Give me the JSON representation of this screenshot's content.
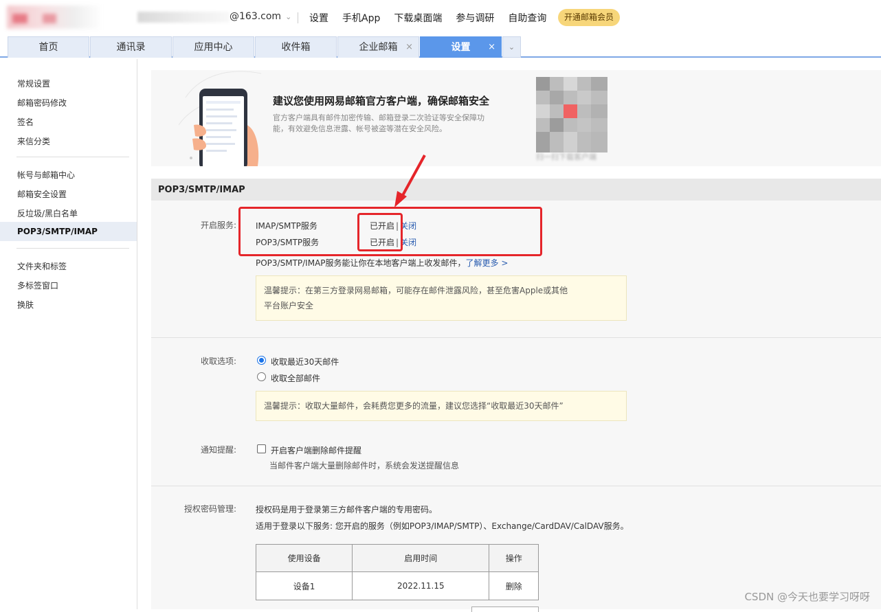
{
  "header": {
    "account_suffix": "@163.com",
    "links": [
      "设置",
      "手机App",
      "下载桌面端",
      "参与调研",
      "自助查询"
    ],
    "vip_button": "开通邮箱会员"
  },
  "tabs": [
    {
      "label": "首页",
      "closable": false,
      "active": false
    },
    {
      "label": "通讯录",
      "closable": false,
      "active": false
    },
    {
      "label": "应用中心",
      "closable": false,
      "active": false
    },
    {
      "label": "收件箱",
      "closable": false,
      "active": false
    },
    {
      "label": "企业邮箱",
      "closable": true,
      "active": false
    },
    {
      "label": "设置",
      "closable": true,
      "active": true
    }
  ],
  "sidebar": {
    "group1": [
      "常规设置",
      "邮箱密码修改",
      "签名",
      "来信分类"
    ],
    "group2": [
      "帐号与邮箱中心",
      "邮箱安全设置",
      "反垃圾/黑白名单",
      "POP3/SMTP/IMAP"
    ],
    "group3": [
      "文件夹和标签",
      "多标签窗口",
      "换肤"
    ],
    "active_item": "POP3/SMTP/IMAP"
  },
  "promo": {
    "title": "建议您使用网易邮箱官方客户端，确保邮箱安全",
    "desc": "官方客户端具有邮件加密传输、邮箱登录二次验证等安全保障功能，有效避免信息泄露、帐号被盗等潜在安全风险。",
    "qr_caption": "扫一扫下载客户端"
  },
  "section": {
    "title": "POP3/SMTP/IMAP",
    "services_label": "开启服务:",
    "services": [
      {
        "name": "IMAP/SMTP服务",
        "status": "已开启",
        "action": "关闭"
      },
      {
        "name": "POP3/SMTP服务",
        "status": "已开启",
        "action": "关闭"
      }
    ],
    "services_desc": "POP3/SMTP/IMAP服务能让你在本地客户端上收发邮件，",
    "learn_more": "了解更多 >",
    "tip1_line1": "温馨提示：在第三方登录网易邮箱，可能存在邮件泄露风险，甚至危害Apple或其他",
    "tip1_line2": "平台账户安全",
    "fetch_label": "收取选项:",
    "fetch_options": [
      {
        "label": "收取最近30天邮件",
        "selected": true
      },
      {
        "label": "收取全部邮件",
        "selected": false
      }
    ],
    "tip2": "温馨提示：收取大量邮件，会耗费您更多的流量，建议您选择“收取最近30天邮件”",
    "notify_label": "通知提醒:",
    "notify_checkbox": "开启客户端删除邮件提醒",
    "notify_desc": "当邮件客户端大量删除邮件时，系统会发送提醒信息",
    "auth_label": "授权密码管理:",
    "auth_desc1": "授权码是用于登录第三方邮件客户端的专用密码。",
    "auth_desc2": "适用于登录以下服务: 您开启的服务（例如POP3/IMAP/SMTP）、Exchange/CardDAV/CalDAV服务。",
    "table_headers": [
      "使用设备",
      "启用时间",
      "操作"
    ],
    "table_rows": [
      {
        "device": "设备1",
        "time": "2022.11.15",
        "action": "删除"
      }
    ]
  },
  "watermark": "CSDN @今天也要学习呀呀",
  "colors": {
    "annotation": "#e5252a",
    "active_tab": "#5b97ea",
    "link": "#2a5db0"
  }
}
